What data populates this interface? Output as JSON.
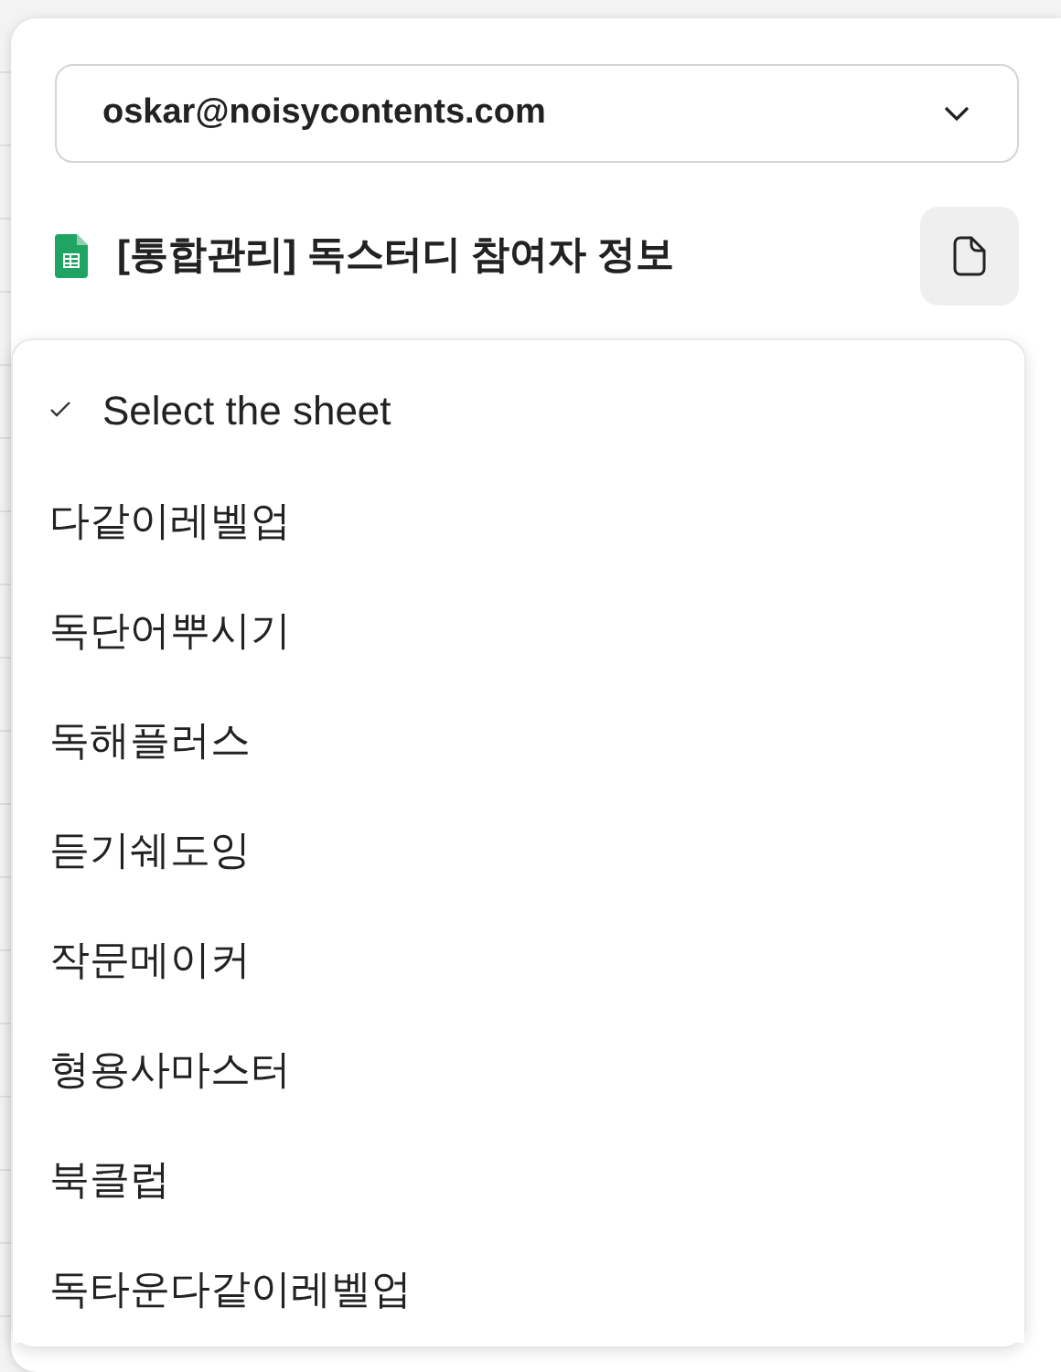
{
  "account_select": {
    "value": "oskar@noisycontents.com"
  },
  "file": {
    "title": "[통합관리] 독스터디 참여자 정보"
  },
  "sheet_options": [
    {
      "label": "Select the sheet",
      "selected": true
    },
    {
      "label": "다같이레벨업",
      "selected": false
    },
    {
      "label": "독단어뿌시기",
      "selected": false
    },
    {
      "label": "독해플러스",
      "selected": false
    },
    {
      "label": "듣기쉐도잉",
      "selected": false
    },
    {
      "label": "작문메이커",
      "selected": false
    },
    {
      "label": "형용사마스터",
      "selected": false
    },
    {
      "label": "북클럽",
      "selected": false
    },
    {
      "label": "독타운다같이레벨업",
      "selected": false
    }
  ]
}
